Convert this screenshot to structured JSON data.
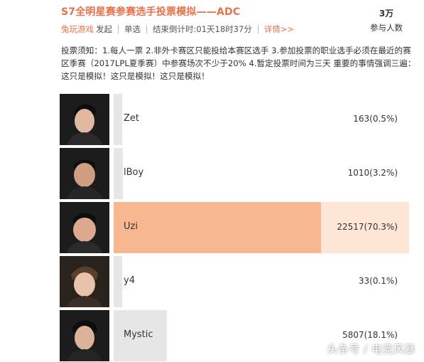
{
  "poll": {
    "title": "S7全明星赛参赛选手投票模拟——ADC",
    "author": "兔玩游戏",
    "posted": "发起",
    "type": "单选",
    "countdown": "结束倒计时:01天18时37分",
    "details": "详情>>",
    "participants": "3万",
    "participants_label": "参与人数",
    "rules": "投票须知：1.每人一票 2.非外卡赛区只能投给本赛区选手 3.参加投票的职业选手必须在最近的赛区季赛（2017LPL夏季赛）中参赛场次不少于20% 4.暂定投票时间为三天 重要的事情强调三遍：这只是模拟！这只是模拟！这只是模拟！"
  },
  "candidates": [
    {
      "name": "Zet",
      "votes": "163(0.5%)",
      "share": 0.005,
      "leading": false
    },
    {
      "name": "lBoy",
      "votes": "1010(3.2%)",
      "share": 0.032,
      "leading": false
    },
    {
      "name": "Uzi",
      "votes": "22517(70.3%)",
      "share": 0.703,
      "leading": true
    },
    {
      "name": "y4",
      "votes": "33(0.1%)",
      "share": 0.001,
      "leading": false
    },
    {
      "name": "Mystic",
      "votes": "5807(18.1%)",
      "share": 0.181,
      "leading": false
    }
  ],
  "watermark": "头条号 / 电竞风暴",
  "colors": {
    "accent": "#e8714a",
    "lead_bar": "#f7b891",
    "lead_bar_bg": "#fde6d5",
    "bar": "#e6e6e6"
  }
}
